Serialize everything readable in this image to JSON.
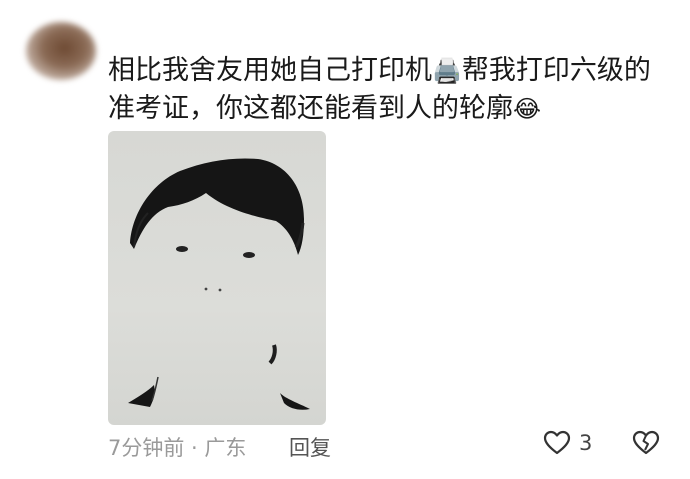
{
  "comment": {
    "username": "",
    "text_part1": "相比我舍友用她自己打印机",
    "emoji_printer": "🖨️",
    "text_part2": "帮我打印六级的准考证，你这都还能看到人的轮廓",
    "emoji_laugh": "😂",
    "time_location": "7分钟前 · 广东",
    "reply_label": "回复",
    "like_count": "3"
  },
  "icons": {
    "like": "heart-outline-icon",
    "dislike": "broken-heart-icon"
  }
}
